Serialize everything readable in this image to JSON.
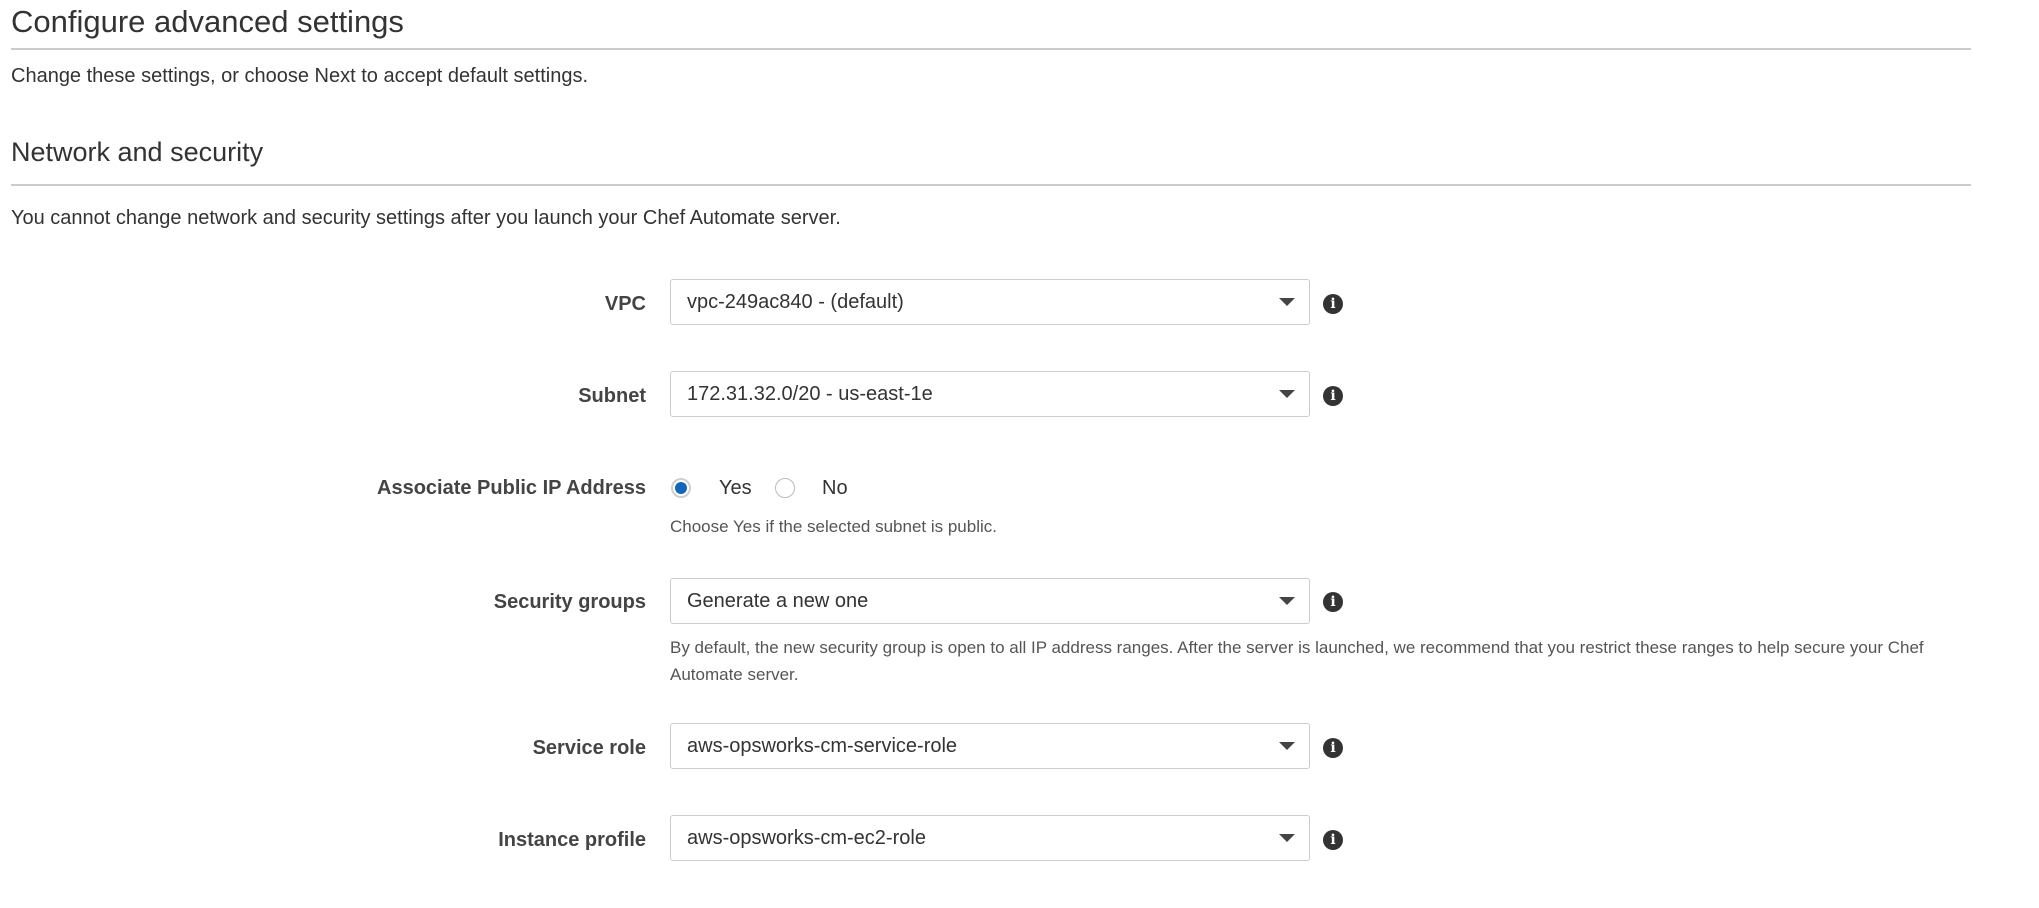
{
  "header": {
    "title": "Configure advanced settings",
    "subtitle": "Change these settings, or choose Next to accept default settings."
  },
  "section": {
    "title": "Network and security",
    "description": "You cannot change network and security settings after you launch your Chef Automate server."
  },
  "fields": {
    "vpc": {
      "label": "VPC",
      "value": "vpc-249ac840 - (default)",
      "icon": "info-icon"
    },
    "subnet": {
      "label": "Subnet",
      "value": "172.31.32.0/20 - us-east-1e",
      "icon": "info-icon"
    },
    "public_ip": {
      "label": "Associate Public IP Address",
      "options": [
        {
          "label": "Yes",
          "checked": true
        },
        {
          "label": "No",
          "checked": false
        }
      ],
      "help": "Choose Yes if the selected subnet is public."
    },
    "security_groups": {
      "label": "Security groups",
      "value": "Generate a new one",
      "help": "By default, the new security group is open to all IP address ranges. After the server is launched, we recommend that you restrict these ranges to help secure your Chef Automate server.",
      "icon": "info-icon"
    },
    "service_role": {
      "label": "Service role",
      "value": "aws-opsworks-cm-service-role",
      "icon": "info-icon"
    },
    "instance_profile": {
      "label": "Instance profile",
      "value": "aws-opsworks-cm-ec2-role",
      "icon": "info-icon"
    }
  },
  "icons": {
    "info_glyph": "i"
  },
  "colors": {
    "radio_selected": "#1166bb",
    "rule": "#cccccc",
    "label": "#444444",
    "help_text": "#555555"
  }
}
